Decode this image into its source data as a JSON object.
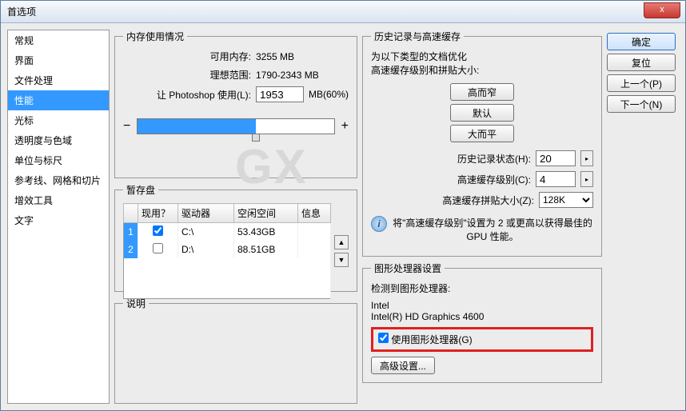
{
  "window": {
    "title": "首选项"
  },
  "close": {
    "label": "x"
  },
  "sidebar": {
    "items": [
      {
        "label": "常规"
      },
      {
        "label": "界面"
      },
      {
        "label": "文件处理"
      },
      {
        "label": "性能",
        "selected": true
      },
      {
        "label": "光标"
      },
      {
        "label": "透明度与色域"
      },
      {
        "label": "单位与标尺"
      },
      {
        "label": "参考线、网格和切片"
      },
      {
        "label": "增效工具"
      },
      {
        "label": "文字"
      }
    ]
  },
  "memory": {
    "legend": "内存使用情况",
    "available_label": "可用内存:",
    "available_value": "3255 MB",
    "ideal_label": "理想范围:",
    "ideal_value": "1790-2343 MB",
    "let_label": "让 Photoshop 使用(L):",
    "let_value": "1953",
    "let_unit": "MB(60%)",
    "minus": "−",
    "plus": "+",
    "slider_pct": 60
  },
  "history": {
    "legend": "历史记录与高速缓存",
    "optimize1": "为以下类型的文档优化",
    "optimize2": "高速缓存级别和拼贴大小:",
    "btn_tall": "高而窄",
    "btn_default": "默认",
    "btn_big": "大而平",
    "states_label": "历史记录状态(H):",
    "states_value": "20",
    "levels_label": "高速缓存级别(C):",
    "levels_value": "4",
    "tile_label": "高速缓存拼贴大小(Z):",
    "tile_value": "128K",
    "info_text": "将\"高速缓存级别\"设置为 2 或更高以获得最佳的 GPU 性能。"
  },
  "scratch": {
    "legend": "暂存盘",
    "cols": {
      "active": "现用？",
      "drive": "驱动器",
      "free": "空闲空间",
      "info": "信息"
    },
    "rows": [
      {
        "n": "1",
        "active": true,
        "drive": "C:\\",
        "free": "53.43GB",
        "info": ""
      },
      {
        "n": "2",
        "active": false,
        "drive": "D:\\",
        "free": "88.51GB",
        "info": ""
      }
    ]
  },
  "gpu": {
    "legend": "图形处理器设置",
    "detected_label": "检测到图形处理器:",
    "vendor": "Intel",
    "model": "Intel(R) HD Graphics 4600",
    "use_gpu_label": "使用图形处理器(G)",
    "adv_btn": "高级设置..."
  },
  "desc": {
    "legend": "说明"
  },
  "buttons": {
    "ok": "确定",
    "reset": "复位",
    "prev": "上一个(P)",
    "next": "下一个(N)"
  }
}
